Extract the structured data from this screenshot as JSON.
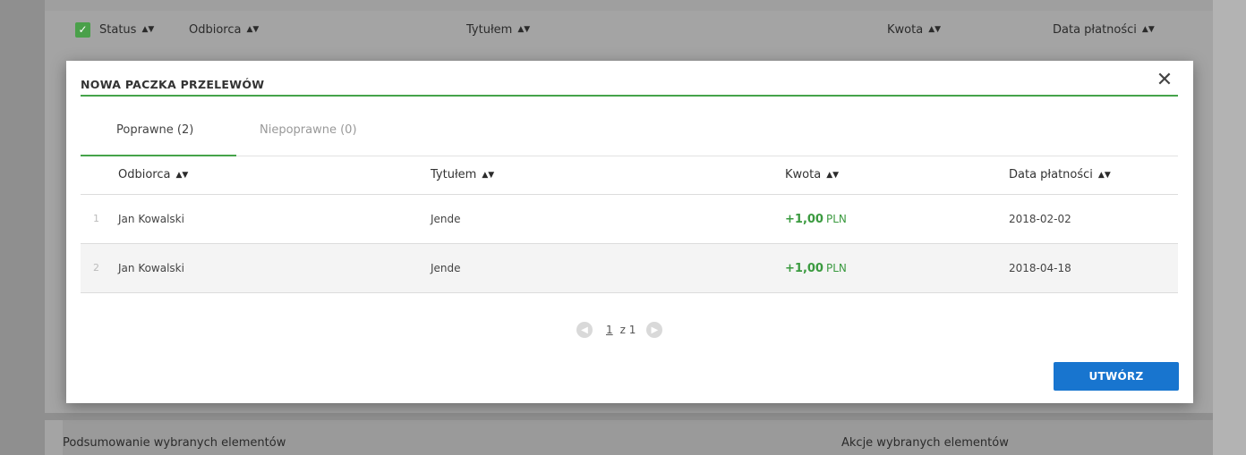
{
  "background": {
    "columns": {
      "status": "Status",
      "recipient": "Odbiorca",
      "title": "Tytułem",
      "amount": "Kwota",
      "date": "Data płatności"
    },
    "summary_label": "Podsumowanie wybranych elementów",
    "actions_label": "Akcje wybranych elementów"
  },
  "modal": {
    "title": "NOWA PACZKA PRZELEWÓW",
    "close_symbol": "✕",
    "tabs": [
      {
        "label": "Poprawne (2)",
        "active": true
      },
      {
        "label": "Niepoprawne (0)",
        "active": false
      }
    ],
    "table": {
      "headers": {
        "recipient": "Odbiorca",
        "title": "Tytułem",
        "amount": "Kwota",
        "date": "Data płatności"
      },
      "rows": [
        {
          "num": "1",
          "recipient": "Jan Kowalski",
          "title": "Jende",
          "amount": "+1,00",
          "currency": "PLN",
          "date": "2018-02-02"
        },
        {
          "num": "2",
          "recipient": "Jan Kowalski",
          "title": "Jende",
          "amount": "+1,00",
          "currency": "PLN",
          "date": "2018-04-18"
        }
      ]
    },
    "pagination": {
      "current": "1",
      "of_label": "z 1"
    },
    "create_button": "UTWÓRZ"
  },
  "colors": {
    "accent_green": "#45a34a",
    "primary_blue": "#1875cf"
  },
  "icons": {
    "sort": "sort-icon",
    "close": "close-icon",
    "prev": "chevron-left-icon",
    "next": "chevron-right-icon",
    "check": "checkbox-checked-icon"
  }
}
